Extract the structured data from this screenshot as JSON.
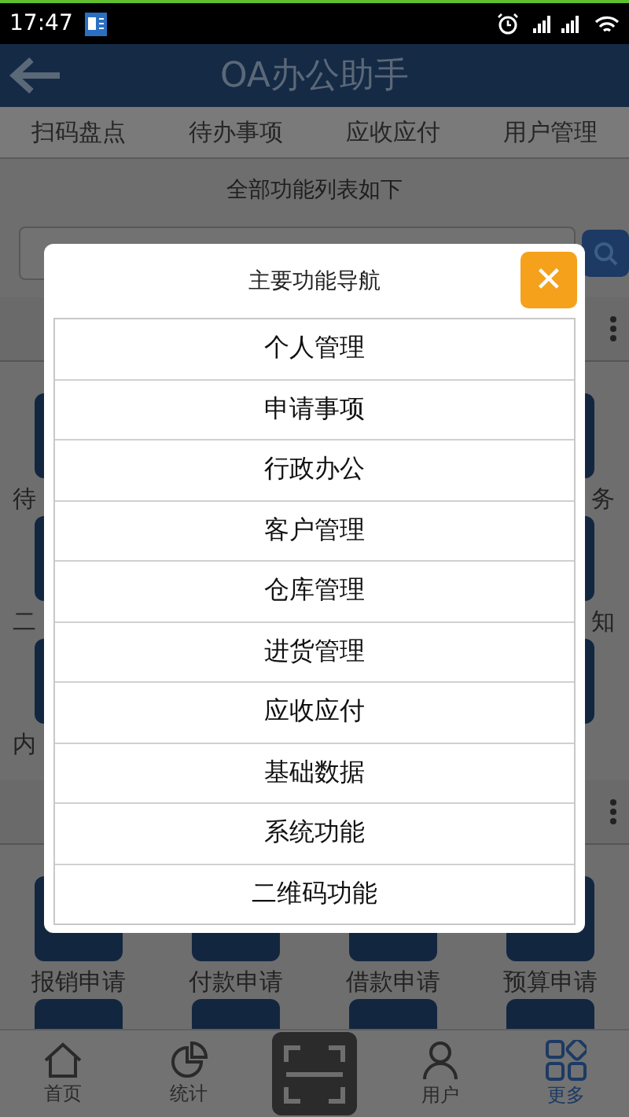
{
  "status_bar": {
    "time": "17:47"
  },
  "header": {
    "title": "OA办公助手"
  },
  "tabs": [
    {
      "label": "扫码盘点"
    },
    {
      "label": "待办事项"
    },
    {
      "label": "应收应付"
    },
    {
      "label": "用户管理"
    }
  ],
  "caption": "全部功能列表如下",
  "sections": [
    {
      "rows": [
        [
          {
            "label": "待"
          },
          {},
          {},
          {
            "label": "务"
          }
        ],
        [
          {
            "label": "二"
          },
          {},
          {},
          {
            "label": "知"
          }
        ],
        [
          {
            "label": "内"
          },
          {},
          {},
          {}
        ]
      ]
    },
    {
      "rows": [
        [
          {
            "label": "报销申请"
          },
          {
            "label": "付款申请"
          },
          {
            "label": "借款申请"
          },
          {
            "label": "预算申请"
          }
        ],
        [
          {},
          {},
          {},
          {}
        ]
      ]
    }
  ],
  "dialog": {
    "title": "主要功能导航",
    "close": "✕",
    "items": [
      "个人管理",
      "申请事项",
      "行政办公",
      "客户管理",
      "仓库管理",
      "进货管理",
      "应收应付",
      "基础数据",
      "系统功能",
      "二维码功能"
    ]
  },
  "bottom_nav": [
    {
      "kind": "home",
      "label": "首页",
      "selected": false
    },
    {
      "kind": "stats",
      "label": "统计",
      "selected": false
    },
    {
      "kind": "scan",
      "selected": false
    },
    {
      "kind": "user",
      "label": "用户",
      "selected": false
    },
    {
      "kind": "more",
      "label": "更多",
      "selected": true
    }
  ]
}
